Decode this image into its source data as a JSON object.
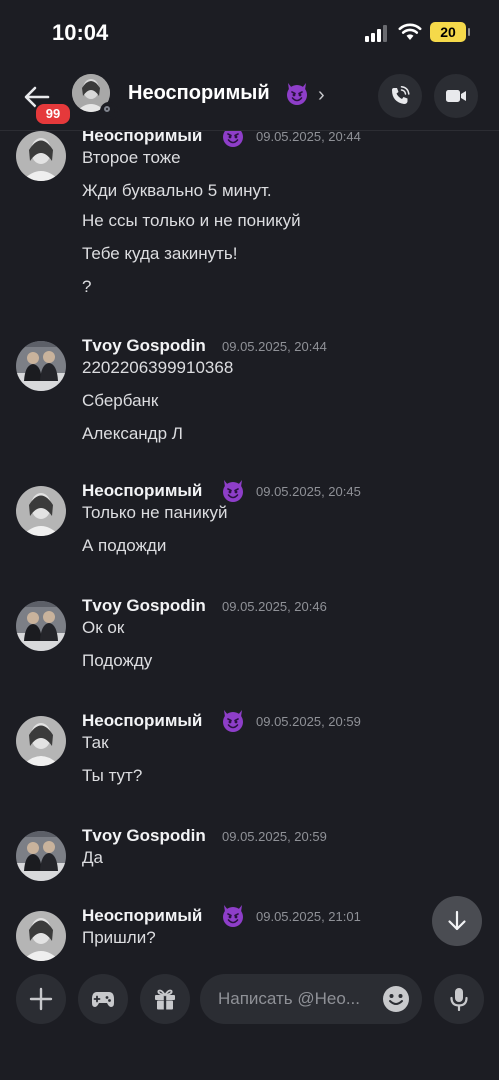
{
  "status_bar": {
    "time": "10:04",
    "battery": "20"
  },
  "header": {
    "unread_badge": "99",
    "name": "Неоспоримый",
    "chevron": "›",
    "icons": {
      "back": "arrow-left-icon",
      "call": "phone-call-icon",
      "video": "video-camera-icon"
    }
  },
  "messages": [
    {
      "author": "Неоспоримый",
      "emoji": "smiling-devil-emoji",
      "timestamp": "09.05.2025, 20:44",
      "lines": [
        "Второе тоже",
        "Жди буквально 5 минут.",
        "Не ссы только и не поникуй",
        "Тебе куда закинуть!",
        "?"
      ]
    },
    {
      "author": "Tvoy Gospodin",
      "timestamp": "09.05.2025, 20:44",
      "lines": [
        "2202206399910368",
        "Сбербанк",
        "Александр Л"
      ]
    },
    {
      "author": "Неоспоримый",
      "emoji": "smiling-devil-emoji",
      "timestamp": "09.05.2025, 20:45",
      "lines": [
        "Только не паникуй",
        "А подожди"
      ]
    },
    {
      "author": "Tvoy Gospodin",
      "timestamp": "09.05.2025, 20:46",
      "lines": [
        "Ок ок",
        "Подожду"
      ]
    },
    {
      "author": "Неоспоримый",
      "emoji": "smiling-devil-emoji",
      "timestamp": "09.05.2025, 20:59",
      "lines": [
        "Так",
        "Ты тут?"
      ]
    },
    {
      "author": "Tvoy Gospodin",
      "timestamp": "09.05.2025, 20:59",
      "lines": [
        "Да"
      ]
    },
    {
      "author": "Неоспоримый",
      "emoji": "smiling-devil-emoji",
      "timestamp": "09.05.2025, 21:01",
      "lines": [
        "Пришли?"
      ]
    }
  ],
  "composer": {
    "placeholder": "Написать @Нео...",
    "icons": {
      "plus": "plus-icon",
      "games": "gamepad-icon",
      "gift": "gift-icon",
      "emoji": "emoji-smile-icon",
      "mic": "microphone-icon"
    }
  },
  "colors": {
    "background": "#1c1d23",
    "badge": "#e5393b",
    "emoji_purple": "#8e3ec9",
    "timestamp": "#8f9197"
  }
}
